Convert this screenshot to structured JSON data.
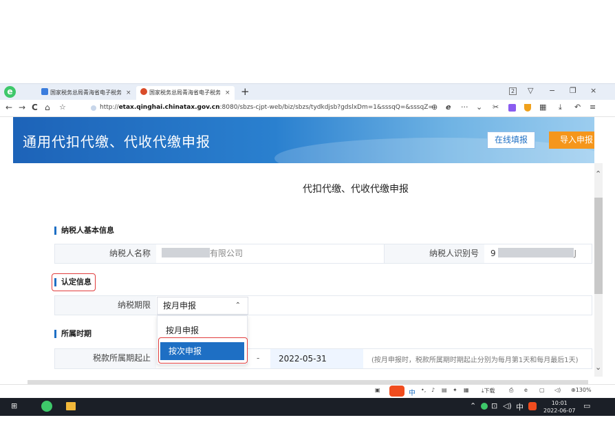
{
  "browser": {
    "tabs": [
      {
        "label": "国家税务总局青海省电子税务",
        "close": "×"
      },
      {
        "label": "国家税务总局青海省电子税务",
        "close": "×"
      }
    ],
    "new_tab": "+",
    "window_controls": [
      "2",
      "▽",
      "−",
      "❐",
      "×"
    ],
    "url_prefix": "http://",
    "url_domain": "etax.qinghai.chinatax.gov.cn",
    "url_rest": ":8080/sbzs-cjpt-web/biz/sbzs/tydkdjsb?gdslxDm=1&sssqQ=&sssqZ="
  },
  "banner": {
    "title": "通用代扣代缴、代收代缴申报",
    "btn_online": "在线填报",
    "btn_import": "导入申报"
  },
  "form": {
    "title": "代扣代缴、代收代缴申报",
    "section_taxpayer": "纳税人基本信息",
    "taxpayer_name_label": "纳税人名称",
    "taxpayer_name_suffix": "有限公司",
    "taxpayer_id_label": "纳税人识别号",
    "taxpayer_id_prefix": "9",
    "taxpayer_id_suffix": "J",
    "section_cert": "认定信息",
    "period_label": "纳税期限",
    "period_value": "按月申报",
    "options": [
      "按月申报",
      "按次申报"
    ],
    "section_period": "所属时期",
    "start_label": "税款所属期起止",
    "dash": "-",
    "end_date": "2022-05-31",
    "hint": "(按月申报时，税款所属期时期起止分别为每月第1天和每月最后1天)"
  },
  "statusbar": {
    "download": "下载",
    "zoom": "130%"
  },
  "taskbar": {
    "ime": "中",
    "time": "10:01",
    "date": "2022-06-07"
  }
}
